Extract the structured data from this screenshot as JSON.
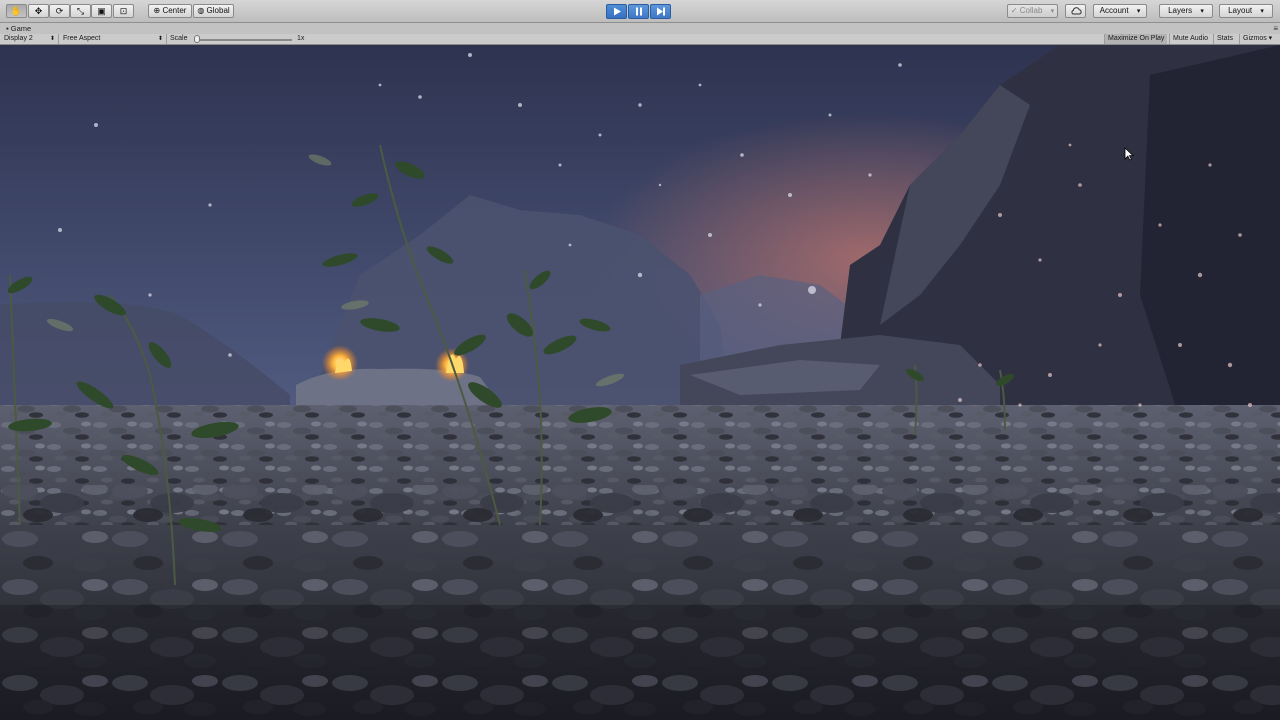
{
  "toolbar": {
    "tools": [
      {
        "name": "hand-tool-button",
        "icon": "hand-icon",
        "glyph": "✋",
        "active": true
      },
      {
        "name": "move-tool-button",
        "icon": "move-icon",
        "glyph": "✥",
        "active": false
      },
      {
        "name": "rotate-tool-button",
        "icon": "rotate-icon",
        "glyph": "⟳",
        "active": false
      },
      {
        "name": "scale-tool-button",
        "icon": "scale-icon",
        "glyph": "⤡",
        "active": false
      },
      {
        "name": "rect-tool-button",
        "icon": "rect-icon",
        "glyph": "▣",
        "active": false
      },
      {
        "name": "transform-tool-button",
        "icon": "transform-icon",
        "glyph": "⊡",
        "active": false
      }
    ],
    "pivot_label": "Center",
    "space_label": "Global",
    "play_state": "playing",
    "collab_label": "Collab",
    "account_label": "Account",
    "layers_label": "Layers",
    "layout_label": "Layout"
  },
  "tab": {
    "title": "Game"
  },
  "game_toolbar": {
    "display": "Display 2",
    "aspect": "Free Aspect",
    "scale_label": "Scale",
    "scale_value": "1x",
    "scale_fraction": 0.0,
    "maximize_on_play": "Maximize On Play",
    "mute_audio": "Mute Audio",
    "stats": "Stats",
    "gizmos": "Gizmos"
  },
  "colors": {
    "accent": "#3b7bd0",
    "toolbar_bg": "#c8c8c8",
    "fire": "#ffb43a",
    "sky": "#3e4b6a"
  }
}
